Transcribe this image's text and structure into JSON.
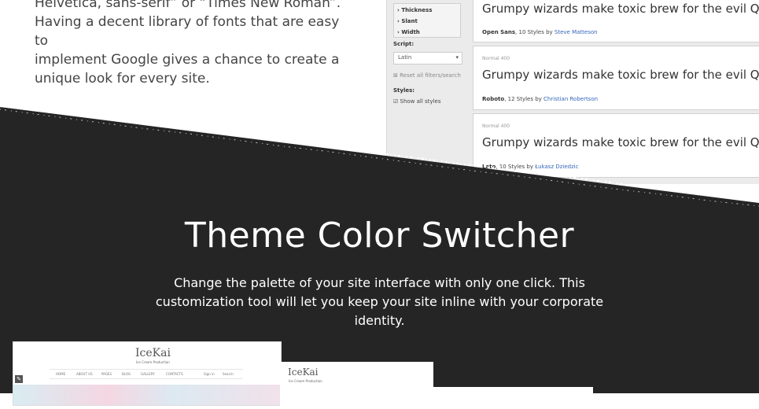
{
  "intro": {
    "lines": [
      "Helvetica, sans-serif” or “Times New Roman”.",
      "Having a decent library of fonts that are easy to",
      "implement Google gives a chance to create a",
      "unique look for every site."
    ]
  },
  "font_panel": {
    "filters": [
      "Thickness",
      "Slant",
      "Width"
    ],
    "script_label": "Script:",
    "script_value": "Latin",
    "reset_label": "Reset all filters/search",
    "styles_label": "Styles:",
    "show_all_label": "Show all styles",
    "cards": [
      {
        "meta": "",
        "sample": "Grumpy wizards make toxic brew for the evil Queen and",
        "font": "Open Sans",
        "styles": ", 10 Styles by ",
        "author": "Steve Matteson"
      },
      {
        "meta": "Normal 400",
        "sample": "Grumpy wizards make toxic brew for the evil Queen and",
        "font": "Roboto",
        "styles": ", 12 Styles by ",
        "author": "Christian Robertson"
      },
      {
        "meta": "Normal 400",
        "sample": "Grumpy wizards make toxic brew for the evil Queen and",
        "font": "Lato",
        "styles": ", 10 Styles by ",
        "author": "Łukasz Dziedzic"
      }
    ]
  },
  "section": {
    "title": "Theme Color Switcher",
    "description": "Change the palette of your site interface with only one click. This customization tool will let you keep your site inline with your corporate identity."
  },
  "previews": {
    "logo": "IceKai",
    "tagline": "Ice Cream Production",
    "nav_items": [
      "HOME",
      "ABOUT US",
      "PAGES",
      "BLOG",
      "GALLERY",
      "CONTACTS"
    ],
    "login": "Sign in",
    "search": "Search"
  },
  "colors": {
    "dark_bg": "#252525",
    "accent_link": "#3366bb"
  }
}
